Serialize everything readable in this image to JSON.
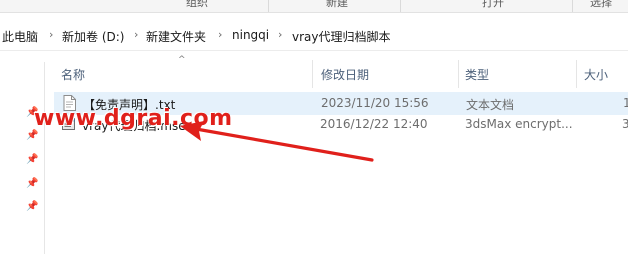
{
  "ribbon": {
    "groups": [
      "组织",
      "新建",
      "打开",
      "选择"
    ]
  },
  "breadcrumb": {
    "items": [
      "此电脑",
      "新加卷 (D:)",
      "新建文件夹",
      "ningqi",
      "vray代理归档脚本"
    ]
  },
  "columns": {
    "name": "名称",
    "date": "修改日期",
    "type": "类型",
    "size": "大小"
  },
  "files": [
    {
      "name": "【免责声明】.txt",
      "date": "2023/11/20 15:56",
      "type": "文本文档",
      "size": "1",
      "icon": "text-file-icon",
      "selected": true
    },
    {
      "name": "vray代理归档.mse",
      "date": "2016/12/22 12:40",
      "type": "3dsMax encrypt...",
      "size": "3",
      "icon": "maxscript-file-icon",
      "selected": false
    }
  ],
  "watermark": {
    "text": "www.dgrai.com",
    "color": "#e0201b"
  },
  "colors": {
    "selection": "#e5f1fb",
    "header_text": "#4c607a",
    "arrow": "#e0201b"
  }
}
